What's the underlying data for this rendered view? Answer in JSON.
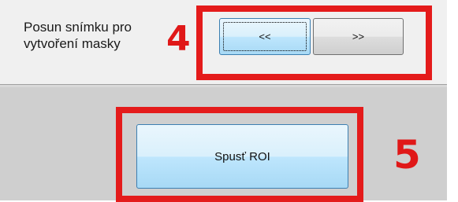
{
  "navigation": {
    "caption_line1": "Posun snímku pro",
    "caption_line2": "vytvoření masky",
    "step_number": "4",
    "prev_label": "<<",
    "next_label": ">>"
  },
  "roi": {
    "button_label": "Spusť ROI",
    "step_number": "5"
  },
  "colors": {
    "highlight_red": "#e41b1b",
    "panel_top": "#f0f0f0",
    "panel_bottom": "#cfcfcf"
  }
}
